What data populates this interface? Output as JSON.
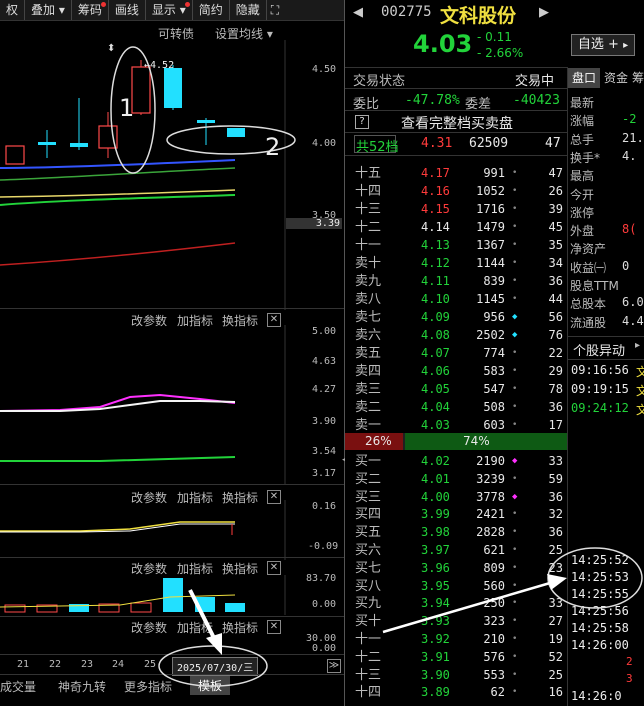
{
  "toolbar": {
    "items": [
      {
        "label": "权",
        "dot": false
      },
      {
        "label": "叠加",
        "dot": false
      },
      {
        "label": "筹码",
        "dot": true
      },
      {
        "label": "画线",
        "dot": false
      },
      {
        "label": "显示",
        "dot": true
      },
      {
        "label": "简约",
        "dot": false
      },
      {
        "label": "隐藏",
        "dot": false
      }
    ],
    "expand": "⛶"
  },
  "chart": {
    "top_links": [
      "可转债",
      "设置均线"
    ],
    "price_label": "←4.52",
    "price_axis": [
      "4.50",
      "4.00",
      "3.50"
    ],
    "price_tag": "3.39",
    "annotation_1": "1",
    "annotation_2": "2"
  },
  "sub1": {
    "btns": [
      "改参数",
      "加指标",
      "换指标"
    ],
    "axis": [
      "5.00",
      "4.63",
      "4.27",
      "3.90",
      "3.54",
      "3.17"
    ]
  },
  "sub2": {
    "btns": [
      "改参数",
      "加指标",
      "换指标"
    ],
    "axis": [
      "0.16",
      "-0.09"
    ]
  },
  "sub3": {
    "btns": [
      "改参数",
      "加指标",
      "换指标"
    ],
    "axis": [
      "83.70",
      "0.00"
    ]
  },
  "sub4": {
    "btns": [
      "改参数",
      "加指标",
      "换指标"
    ],
    "axis": [
      "30.00",
      "0.00"
    ]
  },
  "close_glyph": "✕",
  "dates": {
    "ticks": [
      "21",
      "22",
      "23",
      "24",
      "25"
    ],
    "cursor": "2025/07/30/三",
    "nav": "≫"
  },
  "bottom_tabs": [
    "成交量",
    "神奇九转",
    "更多指标",
    "模板"
  ],
  "stock": {
    "code": "002775",
    "name": "文科股份",
    "price": "4.03",
    "change": "- 0.11",
    "pct": "- 2.66%",
    "watch_btn": "自选",
    "watch_plus": "+",
    "watch_arrow": "▸"
  },
  "status": {
    "label": "交易状态",
    "value": "交易中"
  },
  "ratio": {
    "wb_label": "委比",
    "wb": "-47.78%",
    "wc_label": "委差",
    "wc": "-40423"
  },
  "full_book": {
    "q": "?",
    "label": "查看完整档买卖盘"
  },
  "total": {
    "label": "共52档",
    "price": "4.31",
    "vol": "62509",
    "count": "47"
  },
  "asks": [
    {
      "label": "十五",
      "price": "4.17",
      "vol": "991",
      "mark": "•",
      "cnt": "47",
      "pc": "red"
    },
    {
      "label": "十四",
      "price": "4.16",
      "vol": "1052",
      "mark": "•",
      "cnt": "26",
      "pc": "red"
    },
    {
      "label": "十三",
      "price": "4.15",
      "vol": "1716",
      "mark": "•",
      "cnt": "39",
      "pc": "red"
    },
    {
      "label": "十二",
      "price": "4.14",
      "vol": "1479",
      "mark": "•",
      "cnt": "45",
      "pc": "white"
    },
    {
      "label": "十一",
      "price": "4.13",
      "vol": "1367",
      "mark": "•",
      "cnt": "35",
      "pc": "green"
    },
    {
      "label": "卖十",
      "price": "4.12",
      "vol": "1144",
      "mark": "•",
      "cnt": "34",
      "pc": "green"
    },
    {
      "label": "卖九",
      "price": "4.11",
      "vol": "839",
      "mark": "•",
      "cnt": "36",
      "pc": "green"
    },
    {
      "label": "卖八",
      "price": "4.10",
      "vol": "1145",
      "mark": "•",
      "cnt": "44",
      "pc": "green"
    },
    {
      "label": "卖七",
      "price": "4.09",
      "vol": "956",
      "mark": "◆",
      "cnt": "56",
      "pc": "green"
    },
    {
      "label": "卖六",
      "price": "4.08",
      "vol": "2502",
      "mark": "◆",
      "cnt": "76",
      "pc": "green"
    },
    {
      "label": "卖五",
      "price": "4.07",
      "vol": "774",
      "mark": "•",
      "cnt": "22",
      "pc": "green"
    },
    {
      "label": "卖四",
      "price": "4.06",
      "vol": "583",
      "mark": "•",
      "cnt": "29",
      "pc": "green"
    },
    {
      "label": "卖三",
      "price": "4.05",
      "vol": "547",
      "mark": "•",
      "cnt": "78",
      "pc": "green"
    },
    {
      "label": "卖二",
      "price": "4.04",
      "vol": "508",
      "mark": "•",
      "cnt": "36",
      "pc": "green"
    },
    {
      "label": "卖一",
      "price": "4.03",
      "vol": "603",
      "mark": "•",
      "cnt": "17",
      "pc": "green"
    }
  ],
  "balance": {
    "sell": "26%",
    "buy": "74%",
    "sell_frac": 0.26
  },
  "bids": [
    {
      "label": "买一",
      "price": "4.02",
      "vol": "2190",
      "mark": "◆",
      "cnt": "33",
      "pc": "green"
    },
    {
      "label": "买二",
      "price": "4.01",
      "vol": "3239",
      "mark": "•",
      "cnt": "59",
      "pc": "green"
    },
    {
      "label": "买三",
      "price": "4.00",
      "vol": "3778",
      "mark": "◆",
      "cnt": "36",
      "pc": "green"
    },
    {
      "label": "买四",
      "price": "3.99",
      "vol": "2421",
      "mark": "•",
      "cnt": "32",
      "pc": "green"
    },
    {
      "label": "买五",
      "price": "3.98",
      "vol": "2828",
      "mark": "•",
      "cnt": "36",
      "pc": "green"
    },
    {
      "label": "买六",
      "price": "3.97",
      "vol": "621",
      "mark": "•",
      "cnt": "25",
      "pc": "green"
    },
    {
      "label": "买七",
      "price": "3.96",
      "vol": "809",
      "mark": "•",
      "cnt": "23",
      "pc": "green"
    },
    {
      "label": "买八",
      "price": "3.95",
      "vol": "560",
      "mark": "•",
      "cnt": "",
      "pc": "green"
    },
    {
      "label": "买九",
      "price": "3.94",
      "vol": "250",
      "mark": "•",
      "cnt": "33",
      "pc": "green"
    },
    {
      "label": "买十",
      "price": "3.93",
      "vol": "323",
      "mark": "•",
      "cnt": "27",
      "pc": "green"
    },
    {
      "label": "十一",
      "price": "3.92",
      "vol": "210",
      "mark": "•",
      "cnt": "19",
      "pc": "green"
    },
    {
      "label": "十二",
      "price": "3.91",
      "vol": "576",
      "mark": "•",
      "cnt": "52",
      "pc": "green"
    },
    {
      "label": "十三",
      "price": "3.90",
      "vol": "553",
      "mark": "•",
      "cnt": "25",
      "pc": "green"
    },
    {
      "label": "十四",
      "price": "3.89",
      "vol": "62",
      "mark": "•",
      "cnt": "16",
      "pc": "green"
    }
  ],
  "side_tabs": [
    "盘口",
    "资金",
    "筹"
  ],
  "quote": [
    {
      "label": "最新",
      "value": ""
    },
    {
      "label": "涨幅",
      "value": "-2"
    },
    {
      "label": "总手",
      "value": "21."
    },
    {
      "label": "换手*",
      "value": "4."
    },
    {
      "label": "最高",
      "value": ""
    },
    {
      "label": "今开",
      "value": ""
    },
    {
      "label": "涨停",
      "value": ""
    },
    {
      "label": "外盘",
      "value": "8("
    },
    {
      "label": "净资产",
      "value": ""
    },
    {
      "label": "收益㈠",
      "value": "0"
    },
    {
      "label": "股息TTM",
      "value": ""
    },
    {
      "label": "总股本",
      "value": "6.0"
    },
    {
      "label": "流通股",
      "value": "4.4"
    }
  ],
  "movement": {
    "title": "个股异动",
    "arrow": "▸",
    "times": [
      "09:16:56",
      "09:19:15",
      "09:24:12"
    ],
    "tails": [
      "文",
      "文",
      "文"
    ]
  },
  "ticks": {
    "times": [
      "14:25:52",
      "14:25:53",
      "14:25:55",
      "14:25:56",
      "14:25:58",
      "14:26:00",
      "",
      "",
      "14:26:0"
    ],
    "vals": [
      "",
      "",
      "",
      "",
      "",
      "",
      "2",
      "3",
      ""
    ]
  }
}
